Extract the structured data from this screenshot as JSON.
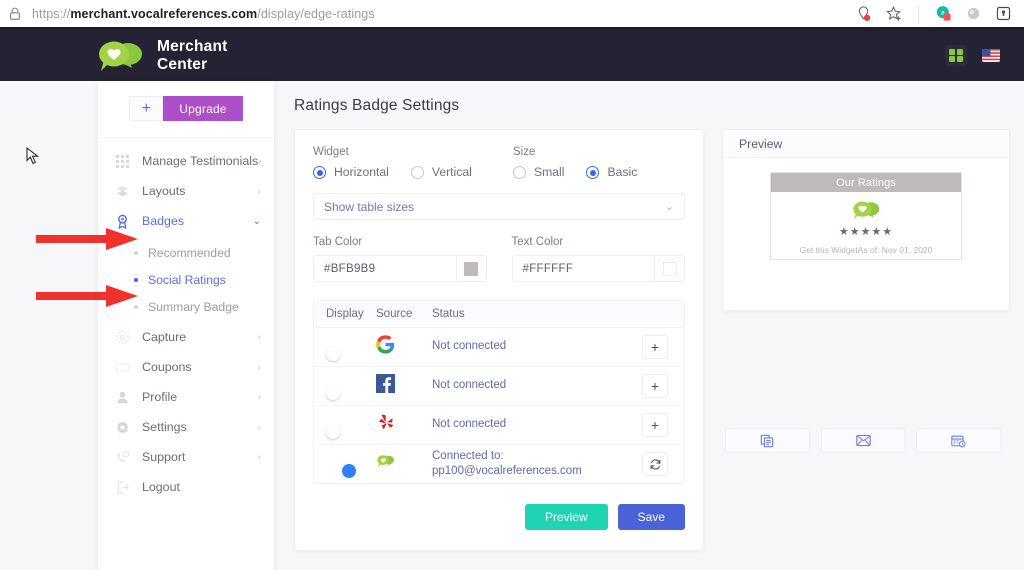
{
  "browser": {
    "url_prefix": "https://",
    "url_host": "merchant.vocalreferences.com",
    "url_path": "/display/edge-ratings",
    "icons": [
      "lock-icon",
      "location-blocked-icon",
      "bookmark-star-icon",
      "extension-badge-icon",
      "extension-gray-icon",
      "extension-dark-icon"
    ]
  },
  "header": {
    "brand_line1": "Merchant",
    "brand_line2": "Center",
    "apps_icon": "apps-grid-icon",
    "locale_icon": "us-flag-icon"
  },
  "sidebar": {
    "plus_label": "+",
    "upgrade_label": "Upgrade",
    "items": [
      {
        "label": "Manage Testimonials",
        "icon": "grid-icon",
        "chevron": "›",
        "active": false
      },
      {
        "label": "Layouts",
        "icon": "layers-icon",
        "chevron": "›",
        "active": false
      },
      {
        "label": "Badges",
        "icon": "badge-ribbon-icon",
        "chevron": "⌄",
        "active": true
      },
      {
        "label": "Capture",
        "icon": "capture-icon",
        "chevron": "›",
        "active": false
      },
      {
        "label": "Coupons",
        "icon": "coupon-icon",
        "chevron": "›",
        "active": false
      },
      {
        "label": "Profile",
        "icon": "user-icon",
        "chevron": "›",
        "active": false
      },
      {
        "label": "Settings",
        "icon": "gear-icon",
        "chevron": "›",
        "active": false
      },
      {
        "label": "Support",
        "icon": "support-phone-icon",
        "chevron": "›",
        "active": false
      },
      {
        "label": "Logout",
        "icon": "logout-icon",
        "chevron": "",
        "active": false
      }
    ],
    "badges_children": [
      {
        "label": "Recommended",
        "active": false
      },
      {
        "label": "Social Ratings",
        "active": true
      },
      {
        "label": "Summary Badge",
        "active": false
      }
    ]
  },
  "main": {
    "page_title": "Ratings Badge Settings",
    "widget_label": "Widget",
    "widget_options": [
      {
        "label": "Horizontal",
        "selected": true
      },
      {
        "label": "Vertical",
        "selected": false
      }
    ],
    "size_label": "Size",
    "size_options": [
      {
        "label": "Small",
        "selected": false
      },
      {
        "label": "Basic",
        "selected": true
      }
    ],
    "table_size_select": "Show table sizes",
    "tab_color_label": "Tab Color",
    "tab_color_value": "#BFB9B9",
    "text_color_label": "Text Color",
    "text_color_value": "#FFFFFF",
    "table": {
      "columns": [
        "Display",
        "Source",
        "Status",
        ""
      ],
      "rows": [
        {
          "source": "google-icon",
          "status": "Not connected",
          "status_line2": "",
          "enabled": false,
          "action": "+",
          "action_name": "add-button"
        },
        {
          "source": "facebook-icon",
          "status": "Not connected",
          "status_line2": "",
          "enabled": false,
          "action": "+",
          "action_name": "add-button"
        },
        {
          "source": "yelp-icon",
          "status": "Not connected",
          "status_line2": "",
          "enabled": false,
          "action": "+",
          "action_name": "add-button"
        },
        {
          "source": "vocalreferences-icon",
          "status": "Connected to:",
          "status_line2": "pp100@vocalreferences.com",
          "enabled": true,
          "action": "↻",
          "action_name": "refresh-button"
        }
      ]
    },
    "preview_button": "Preview",
    "save_button": "Save"
  },
  "preview": {
    "title": "Preview",
    "widget_tab_text": "Our Ratings",
    "widget_tab_bg": "#BFB9B9",
    "widget_tab_color": "#FFFFFF",
    "stars": "★★★★★",
    "footer_left": "Get this Widget",
    "footer_right": "As of: Nov 01, 2020",
    "share_buttons": [
      "copy-code-icon",
      "email-icon",
      "schedule-icon"
    ]
  }
}
